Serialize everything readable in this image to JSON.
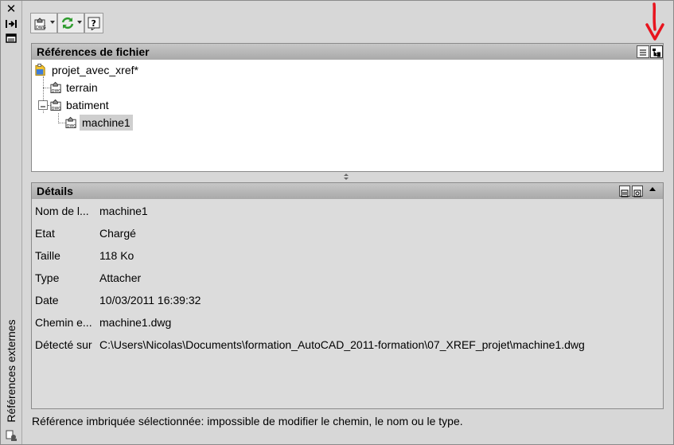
{
  "palette": {
    "title": "Références externes",
    "icons": [
      "close-icon",
      "auto-hide-icon",
      "properties-icon"
    ]
  },
  "toolbar": {
    "buttons": [
      {
        "name": "attach-dwg-icon",
        "has_dropdown": true
      },
      {
        "name": "refresh-icon",
        "has_dropdown": true
      },
      {
        "name": "help-icon",
        "has_dropdown": false
      }
    ]
  },
  "file_references": {
    "title": "Références de fichier",
    "view_buttons": [
      "list-view-icon",
      "tree-view-icon"
    ],
    "tree": [
      {
        "label": "projet_avec_xref*",
        "level": 0,
        "icon": "drawing-file-icon"
      },
      {
        "label": "terrain",
        "level": 1,
        "icon": "dwg-xref-icon"
      },
      {
        "label": "batiment",
        "level": 1,
        "icon": "dwg-xref-icon",
        "expanded": true
      },
      {
        "label": "machine1",
        "level": 2,
        "icon": "dwg-xref-icon",
        "selected": true
      }
    ]
  },
  "details": {
    "title": "Détails",
    "rows": [
      {
        "key": "Nom de l...",
        "value": "machine1"
      },
      {
        "key": "Etat",
        "value": "Chargé"
      },
      {
        "key": "Taille",
        "value": "118 Ko"
      },
      {
        "key": "Type",
        "value": "Attacher"
      },
      {
        "key": "Date",
        "value": "10/03/2011 16:39:32"
      },
      {
        "key": "Chemin e...",
        "value": "machine1.dwg"
      },
      {
        "key": "Détecté sur",
        "value": "C:\\Users\\Nicolas\\Documents\\formation_AutoCAD_2011-formation\\07_XREF_projet\\machine1.dwg"
      }
    ]
  },
  "status_message": "Référence imbriquée sélectionnée: impossible de modifier le chemin, le nom ou le type.",
  "colors": {
    "annotation_arrow": "#e8141e",
    "selection_bg": "#cfcfcf",
    "header_bg": "#b4b4b4"
  }
}
